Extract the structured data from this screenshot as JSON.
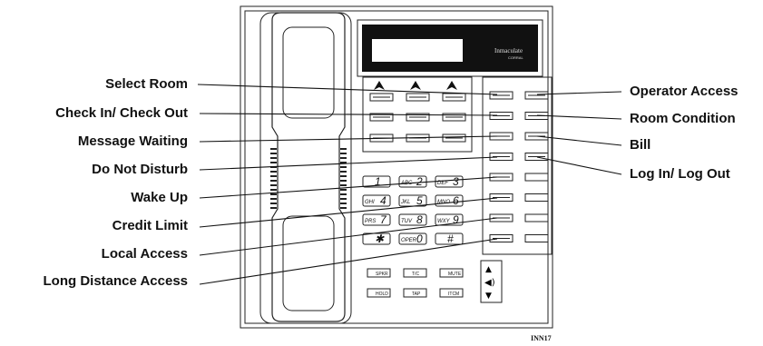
{
  "left_labels": [
    "Select Room",
    "Check In/ Check Out",
    "Message Waiting",
    "Do Not Disturb",
    "Wake Up",
    "Credit Limit",
    "Local Access",
    "Long Distance Access"
  ],
  "right_labels": [
    "Operator Access",
    "Room Condition",
    "Bill",
    "Log In/ Log Out"
  ],
  "dial_keys": [
    {
      "sub": "",
      "num": "1"
    },
    {
      "sub": "ABC",
      "num": "2"
    },
    {
      "sub": "DEF",
      "num": "3"
    },
    {
      "sub": "GHI",
      "num": "4"
    },
    {
      "sub": "JKL",
      "num": "5"
    },
    {
      "sub": "MNO",
      "num": "6"
    },
    {
      "sub": "PRS",
      "num": "7"
    },
    {
      "sub": "TUV",
      "num": "8"
    },
    {
      "sub": "WXY",
      "num": "9"
    },
    {
      "sub": "",
      "num": "✱"
    },
    {
      "sub": "OPER",
      "num": "0"
    },
    {
      "sub": "",
      "num": "#"
    }
  ],
  "function_keys": [
    "SPKR",
    "T/C",
    "MUTE",
    "HOLD",
    "TAP",
    "ITCM"
  ],
  "display": {
    "brand": "Inmaculate",
    "brand_sub": "CORRAL"
  },
  "figure_code": "INN17"
}
